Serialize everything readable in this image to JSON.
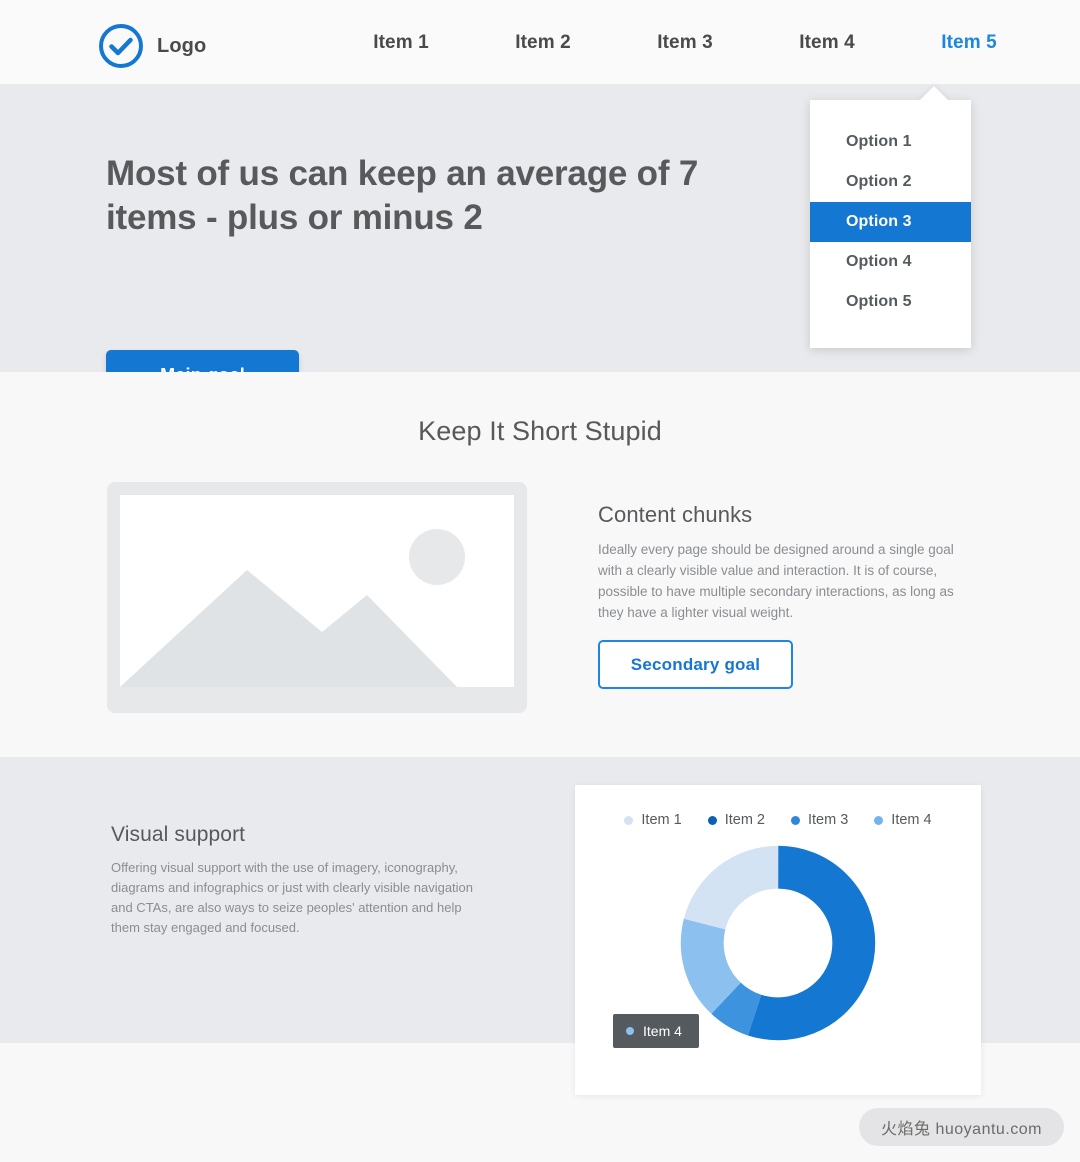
{
  "header": {
    "logo_icon": "check-circle-icon",
    "brand_name": "Logo",
    "nav_items": [
      {
        "label": "Item 1",
        "active": false
      },
      {
        "label": "Item 2",
        "active": false
      },
      {
        "label": "Item 3",
        "active": false
      },
      {
        "label": "Item 4",
        "active": false
      },
      {
        "label": "Item 5",
        "active": true
      }
    ]
  },
  "dropdown": {
    "options": [
      {
        "label": "Option 1",
        "selected": false
      },
      {
        "label": "Option 2",
        "selected": false
      },
      {
        "label": "Option 3",
        "selected": true
      },
      {
        "label": "Option 4",
        "selected": false
      },
      {
        "label": "Option 5",
        "selected": false
      }
    ]
  },
  "hero": {
    "title": "Most of us can keep an average of 7 items - plus or minus 2",
    "primary_button": "Main goal"
  },
  "section_short": {
    "title": "Keep It Short Stupid",
    "image_placeholder_icon": "image-placeholder-icon",
    "content_title": "Content chunks",
    "content_body": "Ideally every page should be designed around a single goal with a clearly visible value and interaction. It is of course, possible to have multiple secondary interactions, as long as they have a lighter visual weight.",
    "secondary_button": "Secondary goal"
  },
  "section_visual": {
    "title": "Visual support",
    "body": "Offering visual support with the use of imagery, iconography, diagrams and infographics or just with clearly visible navigation and CTAs, are also ways to seize peoples' attention and help them stay engaged and focused."
  },
  "chart_data": {
    "type": "pie",
    "variant": "donut",
    "title": "",
    "legend_position": "top",
    "categories": [
      "Item 1",
      "Item 2",
      "Item 3",
      "Item 4"
    ],
    "values": [
      21,
      55,
      7,
      17
    ],
    "colors": [
      "#d3e3f3",
      "#1477d1",
      "#3d93dd",
      "#8cc0ef"
    ],
    "tooltip": {
      "label": "Item 4",
      "color": "#8cc0ef"
    }
  },
  "colors": {
    "accent": "#1477d1",
    "accent_light": "#1c86e0",
    "text_dark": "#58595b",
    "text_muted": "#8a8d91",
    "bg_gray": "#e8eaed",
    "bg_light": "#f8f8f9"
  },
  "watermark": {
    "text": "火焰兔 huoyantu.com"
  }
}
